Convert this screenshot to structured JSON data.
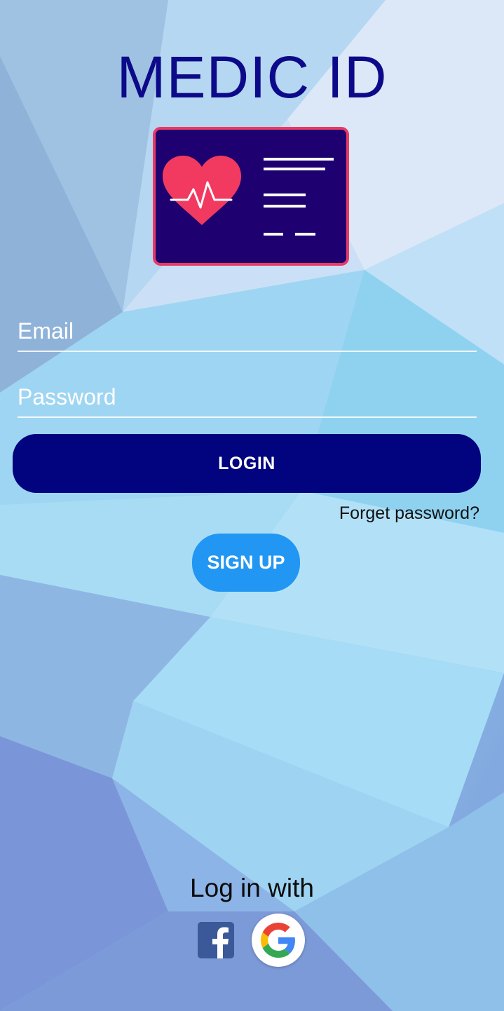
{
  "app": {
    "title": "MEDIC ID",
    "logo_icon": "medical-id-card-icon"
  },
  "login_form": {
    "email_placeholder": "Email",
    "password_placeholder": "Password",
    "login_label": "LOGIN",
    "forgot_label": "Forget password?",
    "signup_label": "SIGN UP"
  },
  "social": {
    "label": "Log in with",
    "providers": [
      {
        "name": "facebook",
        "icon": "facebook-icon"
      },
      {
        "name": "google",
        "icon": "google-icon"
      }
    ]
  },
  "colors": {
    "title": "#0d0a8a",
    "login_button": "#01037f",
    "signup_button": "#2196f3",
    "card_background": "#1e0070",
    "card_border": "#e83a64",
    "heart": "#f23a60",
    "facebook": "#3b5998"
  }
}
